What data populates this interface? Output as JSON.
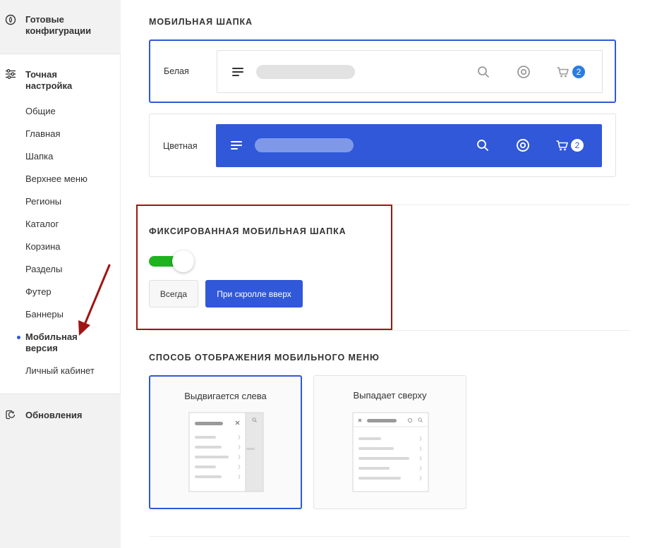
{
  "sidebar": {
    "sections": [
      {
        "title_line1": "Готовые",
        "title_line2": "конфигурации",
        "icon": "palette-icon"
      },
      {
        "title_line1": "Точная",
        "title_line2": "настройка",
        "icon": "sliders-icon"
      },
      {
        "title": "Обновления",
        "icon": "update-icon"
      }
    ],
    "items": [
      "Общие",
      "Главная",
      "Шапка",
      "Верхнее меню",
      "Регионы",
      "Каталог",
      "Корзина",
      "Разделы",
      "Футер",
      "Баннеры",
      {
        "line1": "Мобильная",
        "line2": "версия"
      },
      "Личный кабинет"
    ],
    "active_index": 10
  },
  "mobile_header": {
    "heading": "МОБИЛЬНАЯ ШАПКА",
    "options": [
      {
        "label": "Белая",
        "cart_count": "2",
        "selected": true
      },
      {
        "label": "Цветная",
        "cart_count": "2",
        "selected": false
      }
    ]
  },
  "fixed_header": {
    "heading": "ФИКСИРОВАННАЯ МОБИЛЬНАЯ ШАПКА",
    "enabled": true,
    "buttons": [
      {
        "label": "Всегда",
        "selected": false
      },
      {
        "label": "При скролле вверх",
        "selected": true
      }
    ]
  },
  "menu_display": {
    "heading": "СПОСОБ ОТОБРАЖЕНИЯ МОБИЛЬНОГО МЕНЮ",
    "options": [
      {
        "label": "Выдвигается слева",
        "selected": true
      },
      {
        "label": "Выпадает сверху",
        "selected": false
      }
    ]
  },
  "colors": {
    "accent": "#3058d8",
    "toggle_on": "#1fb31f",
    "annotation": "#a01414",
    "cart_badge_blue": "#2a7de1"
  },
  "icons": {
    "burger": "hamburger-icon",
    "search": "search-icon",
    "account": "user-circle-icon",
    "cart": "cart-icon",
    "close": "close-icon",
    "chevron": "chevron-right-icon"
  }
}
